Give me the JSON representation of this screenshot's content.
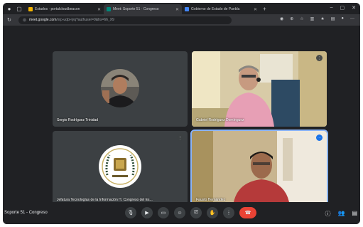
{
  "browser": {
    "tabs": [
      {
        "title": "Estados · portalcloudbeacon",
        "favicon_color": "#f4b400",
        "active": false
      },
      {
        "title": "Meet: Soporte 51 · Congreso",
        "favicon_color": "#00897b",
        "active": true
      },
      {
        "title": "Gobierno de Estado de Puebla",
        "favicon_color": "#4285f4",
        "active": false
      }
    ],
    "url_host": "meet.google.com",
    "url_path": "/xrp-uqbi-lyq?authuser=0&hs=66_X9"
  },
  "meet": {
    "participants": [
      {
        "name": "Sergio Rodríguez Trinidad",
        "kind": "avatar-photo"
      },
      {
        "name": "Gabriel Rodríguez Domínguez",
        "kind": "video"
      },
      {
        "name": "Jefatura Tecnologías de la Información H. Congreso del Es...",
        "kind": "avatar-logo"
      },
      {
        "name": "Fausto Hernández",
        "kind": "video",
        "speaking": true
      }
    ],
    "meeting_title": "Soporte 51 - Congreso"
  },
  "colors": {
    "background": "#202124",
    "tile": "#3c4043",
    "end_call": "#ea4335",
    "speaking_outline": "#8ab4f8"
  }
}
